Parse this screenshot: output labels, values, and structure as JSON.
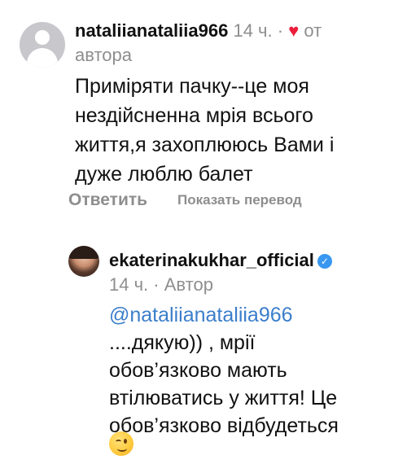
{
  "comment": {
    "username": "nataliianataliia966",
    "time": "14 ч.",
    "separator": "·",
    "liked_by_author": "от",
    "liked_by_author_line2": "автора",
    "text": "Приміряти пачку--це моя\nнездійсненна мрія всього\nжиття,я захоплююсь Вами і\nдуже люблю балет",
    "reply_label": "Ответить",
    "translate_label": "Показать перевод"
  },
  "reply": {
    "username": "ekaterinakukhar_official",
    "verified_mark": "✓",
    "time": "14 ч.",
    "separator": "·",
    "author_label": "Автор",
    "mention": "@nataliianataliia966",
    "text": "\n....дякую)) , мрії\nобов’язково мають\nвтілюватись у життя! Це\nобов’язково відбудеться"
  },
  "icons": {
    "heart": "heart-icon",
    "verified": "verified-badge-icon",
    "emoji": "winking-face-icon"
  },
  "colors": {
    "heart": "#ed1c3a",
    "mention": "#3b7ecb",
    "meta": "#8e8e8e",
    "verified": "#3897f0"
  }
}
